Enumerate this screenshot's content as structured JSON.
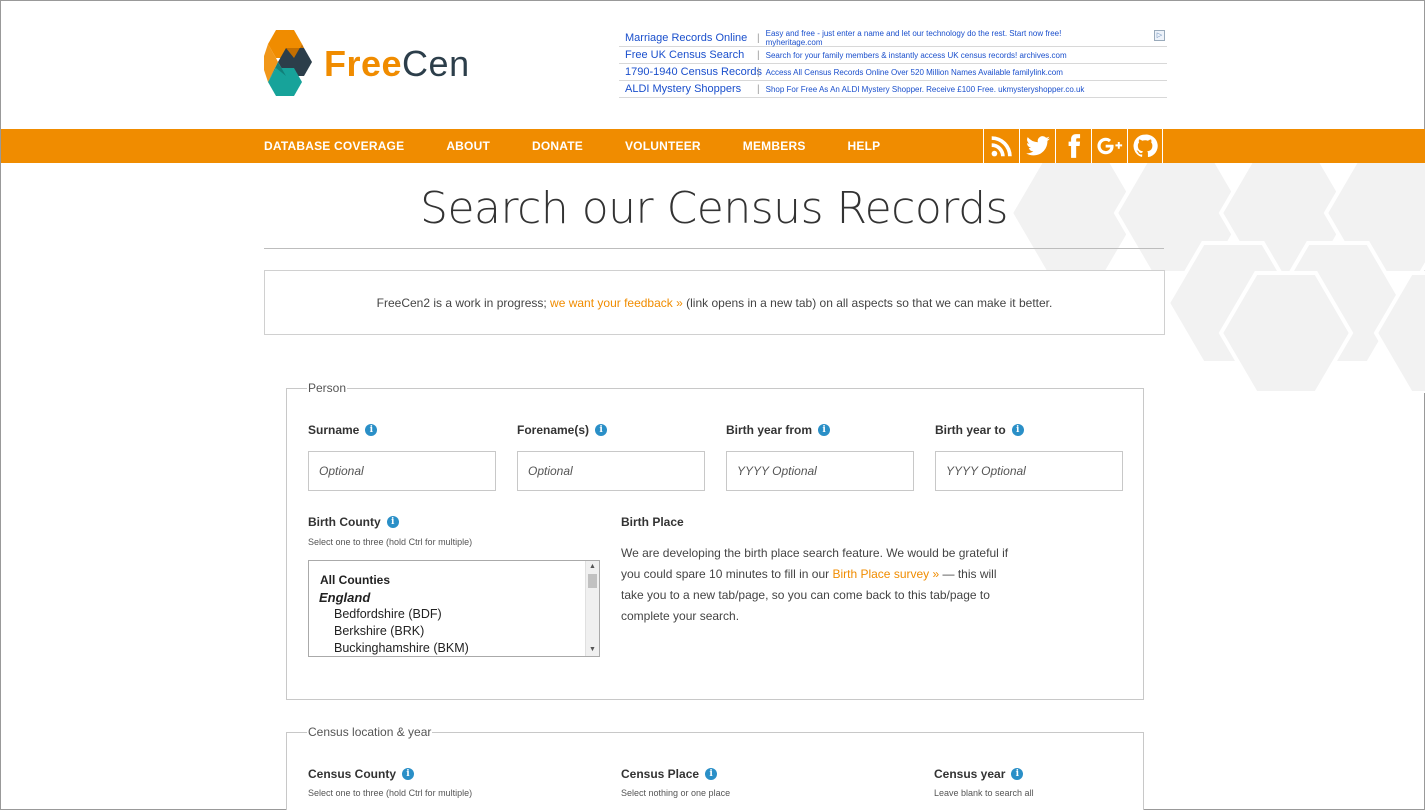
{
  "logo": {
    "free": "Free",
    "cen": "Cen"
  },
  "ads": [
    {
      "title": "Marriage Records Online",
      "desc": "Easy and free - just enter a name and let our technology do the rest. Start now free! myheritage.com"
    },
    {
      "title": "Free UK Census Search",
      "desc": "Search for your family members & instantly access UK census records! archives.com"
    },
    {
      "title": "1790-1940 Census Records",
      "desc": "Access All Census Records Online Over 520 Million Names Available familylink.com"
    },
    {
      "title": "ALDI Mystery Shoppers",
      "desc": "Shop For Free As An ALDI Mystery Shopper. Receive £100 Free. ukmysteryshopper.co.uk"
    }
  ],
  "ad_marker": "▷",
  "nav": [
    "DATABASE COVERAGE",
    "ABOUT",
    "DONATE",
    "VOLUNTEER",
    "MEMBERS",
    "HELP"
  ],
  "social": [
    "rss-icon",
    "twitter-icon",
    "facebook-icon",
    "google-plus-icon",
    "github-icon"
  ],
  "page_title": "Search our Census Records",
  "notice": {
    "before": "FreeCen2 is a work in progress; ",
    "link": "we want your feedback »",
    "after": " (link opens in a new tab) on all aspects so that we can make it better."
  },
  "person": {
    "legend": "Person",
    "surname": {
      "label": "Surname",
      "placeholder": "Optional"
    },
    "forenames": {
      "label": "Forename(s)",
      "placeholder": "Optional"
    },
    "birth_year_from": {
      "label": "Birth year from",
      "placeholder": "YYYY Optional"
    },
    "birth_year_to": {
      "label": "Birth year to",
      "placeholder": "YYYY Optional"
    },
    "birth_county": {
      "label": "Birth County",
      "hint": "Select one to three (hold Ctrl for multiple)",
      "options": {
        "all": "All Counties",
        "group": "England",
        "counties": [
          "Bedfordshire (BDF)",
          "Berkshire (BRK)",
          "Buckinghamshire (BKM)"
        ]
      }
    },
    "birth_place": {
      "label": "Birth Place",
      "text_before": "We are developing the birth place search feature. We would be grateful if you could spare 10 minutes to fill in our ",
      "link": "Birth Place survey »",
      "text_after": " — this will take you to a new tab/page, so you can come back to this tab/page to complete your search."
    }
  },
  "census": {
    "legend": "Census location & year",
    "county": {
      "label": "Census County",
      "hint": "Select one to three (hold Ctrl for multiple)"
    },
    "place": {
      "label": "Census Place",
      "hint": "Select nothing or one place"
    },
    "year": {
      "label": "Census year",
      "hint": "Leave blank to search all"
    }
  },
  "colors": {
    "accent": "#f08c00",
    "info": "#2a8fc7",
    "dark": "#2c3e4a",
    "teal": "#17a39a"
  }
}
